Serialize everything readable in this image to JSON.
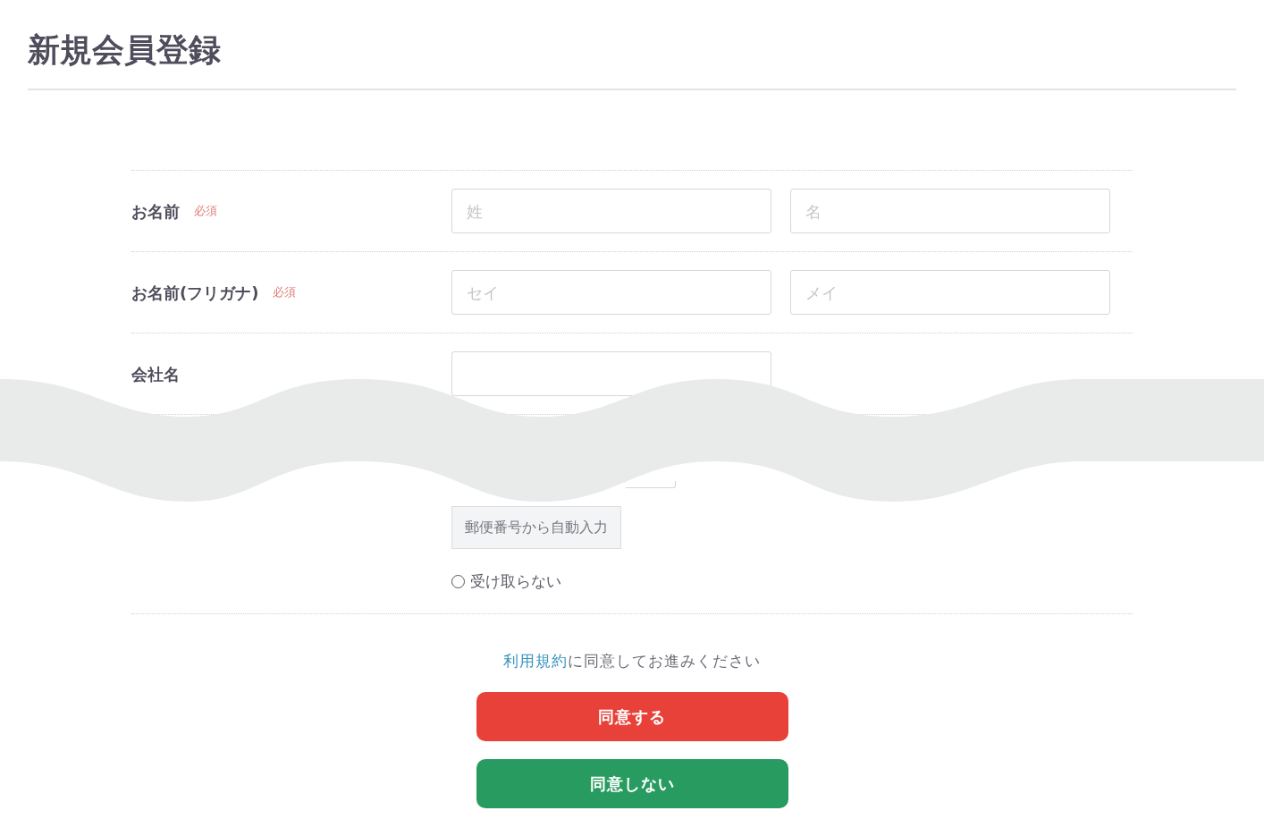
{
  "page": {
    "title": "新規会員登録"
  },
  "form": {
    "rows": [
      {
        "label": "お名前",
        "required_text": "必須",
        "fields": [
          {
            "kind": "text",
            "placeholder": "姓"
          },
          {
            "kind": "text",
            "placeholder": "名"
          }
        ]
      },
      {
        "label": "お名前(フリガナ)",
        "required_text": "必須",
        "fields": [
          {
            "kind": "text",
            "placeholder": "セイ"
          },
          {
            "kind": "text",
            "placeholder": "メイ"
          }
        ]
      },
      {
        "label": "会社名",
        "fields": [
          {
            "kind": "text"
          }
        ]
      }
    ],
    "postal_button": "郵便番号から自動入力",
    "radio_option": {
      "label": "受け取らない",
      "selected": false
    }
  },
  "terms": {
    "link": "利用規約",
    "text": "に同意してお進みください"
  },
  "buttons": [
    {
      "label": "同意する",
      "kind": "agree"
    },
    {
      "label": "同意しない",
      "kind": "disagree"
    }
  ]
}
